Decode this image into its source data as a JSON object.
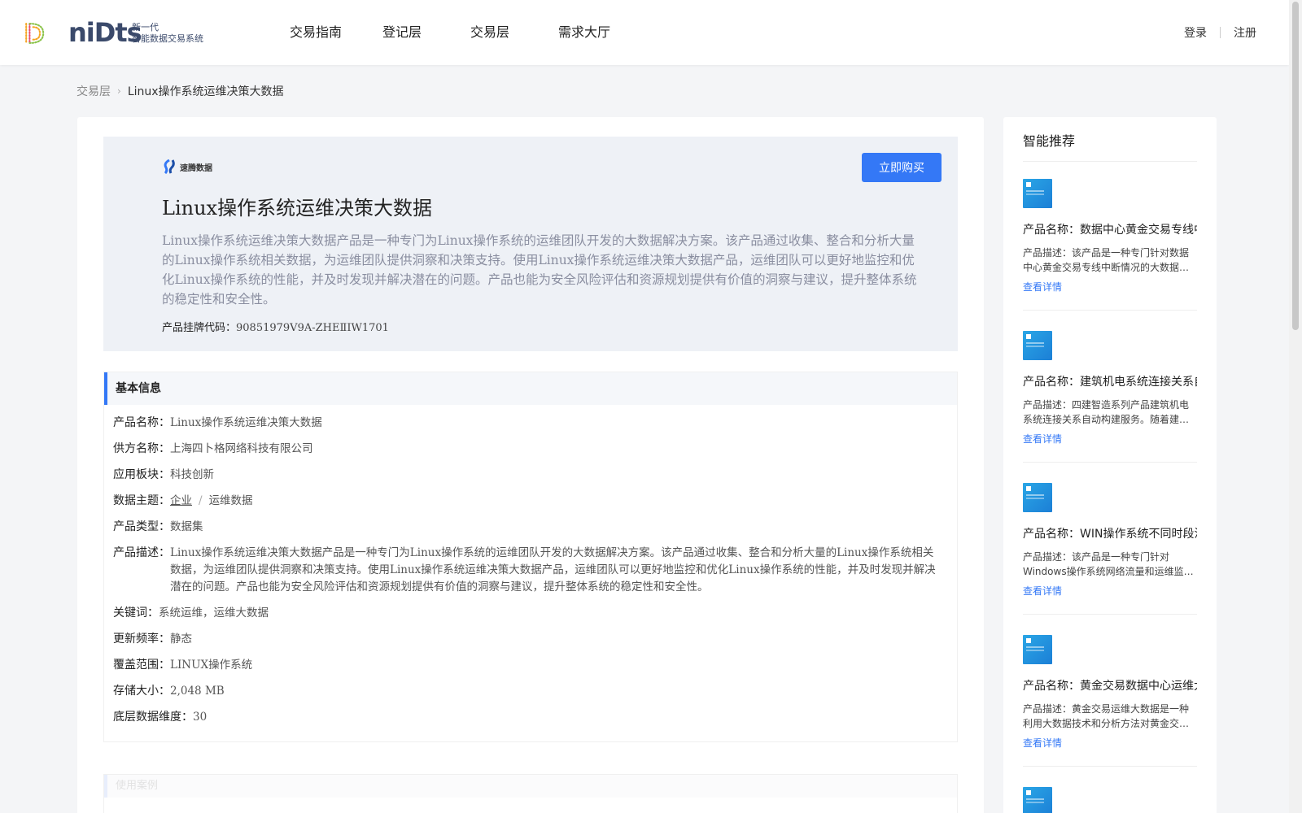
{
  "header": {
    "logo_text": "niDts",
    "logo_sub1": "新一代",
    "logo_sub2": "智能数据交易系统",
    "nav": [
      "交易指南",
      "登记层",
      "交易层",
      "需求大厅"
    ],
    "login": "登录",
    "register": "注册"
  },
  "breadcrumb": {
    "parent": "交易层",
    "current": "Linux操作系统运维决策大数据"
  },
  "product": {
    "vendor_logo_text": "速腾数据",
    "buy_label": "立即购买",
    "title": "Linux操作系统运维决策大数据",
    "description": "Linux操作系统运维决策大数据产品是一种专门为Linux操作系统的运维团队开发的大数据解决方案。该产品通过收集、整合和分析大量的Linux操作系统相关数据，为运维团队提供洞察和决策支持。使用Linux操作系统运维决策大数据产品，运维团队可以更好地监控和优化Linux操作系统的性能，并及时发现并解决潜在的问题。产品也能为安全风险评估和资源规划提供有价值的洞察与建议，提升整体系统的稳定性和安全性。",
    "code_label": "产品挂牌代码：",
    "code_value": "90851979V9A-ZHEⅡIW1701"
  },
  "basic_info": {
    "heading": "基本信息",
    "rows": [
      {
        "k": "产品名称：",
        "v": "Linux操作系统运维决策大数据"
      },
      {
        "k": "供方名称：",
        "v": "上海四卜格网络科技有限公司"
      },
      {
        "k": "应用板块：",
        "v": "科技创新"
      },
      {
        "k": "数据主题：",
        "v1": "企业",
        "sep": "/",
        "v2": "运维数据"
      },
      {
        "k": "产品类型：",
        "v": "数据集"
      },
      {
        "k": "产品描述：",
        "v": "Linux操作系统运维决策大数据产品是一种专门为Linux操作系统的运维团队开发的大数据解决方案。该产品通过收集、整合和分析大量的Linux操作系统相关数据，为运维团队提供洞察和决策支持。使用Linux操作系统运维决策大数据产品，运维团队可以更好地监控和优化Linux操作系统的性能，并及时发现并解决潜在的问题。产品也能为安全风险评估和资源规划提供有价值的洞察与建议，提升整体系统的稳定性和安全性。"
      },
      {
        "k": "关键词：",
        "v": "系统运维，运维大数据"
      },
      {
        "k": "更新频率：",
        "v": "静态"
      },
      {
        "k": "覆盖范围：",
        "v": "LINUX操作系统"
      },
      {
        "k": "存储大小：",
        "v": "2,048 MB"
      },
      {
        "k": "底层数据维度：",
        "v": "30"
      }
    ]
  },
  "blurred_section_heading": "使用案例",
  "sidebar": {
    "title": "智能推荐",
    "link_label": "查看详情",
    "items": [
      {
        "name": "产品名称：数据中心黄金交易专线中断情况",
        "desc": "产品描述：该产品是一种专门针对数据中心黄金交易专线中断情况的大数据解决方案"
      },
      {
        "name": "产品名称：建筑机电系统连接关系自动构建",
        "desc": "产品描述：四建智造系列产品建筑机电系统连接关系自动构建服务。随着建筑行业的发展"
      },
      {
        "name": "产品名称：WIN操作系统不同时段流量数据",
        "desc": "产品描述：该产品是一种专门针对Windows操作系统网络流量和运维监控的解决方案"
      },
      {
        "name": "产品名称：黄金交易数据中心运维大数据",
        "desc": "产品描述：黄金交易运维大数据是一种利用大数据技术和分析方法对黄金交易数据中心进行运维"
      }
    ]
  }
}
